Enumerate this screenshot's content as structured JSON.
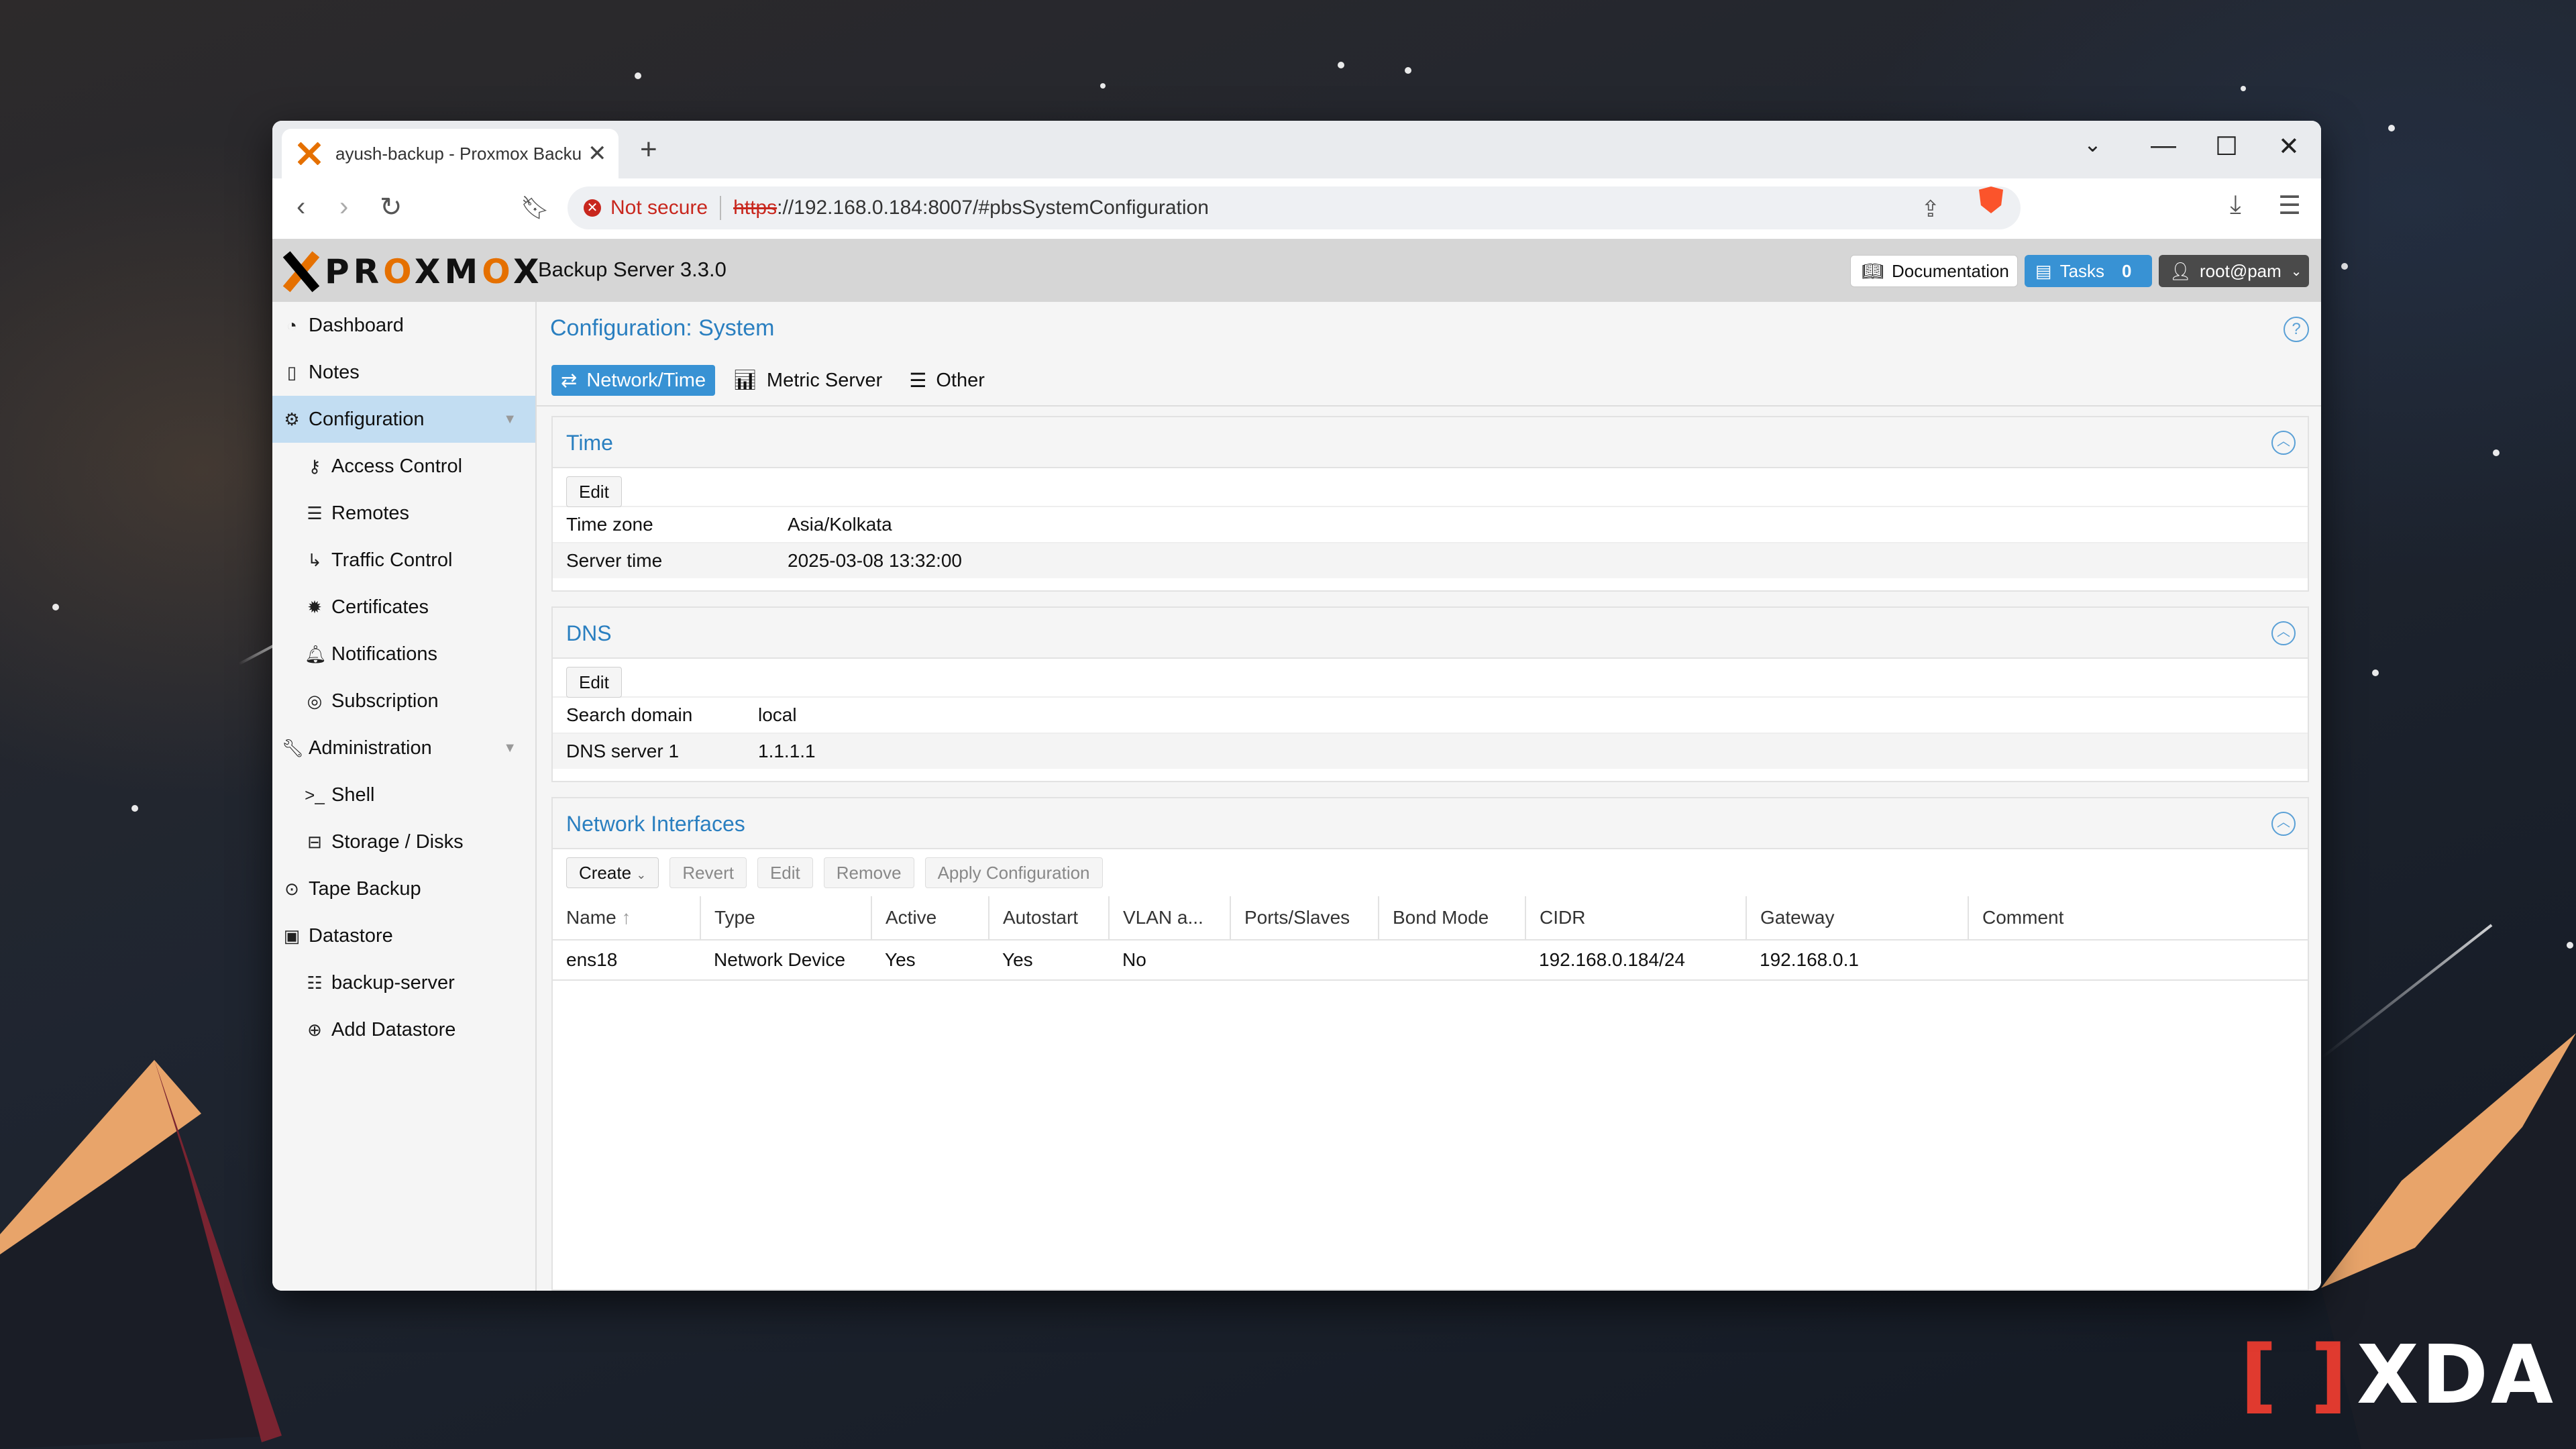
{
  "browser": {
    "tab_title": "ayush-backup - Proxmox Backu",
    "not_secure": "Not secure",
    "url_scheme": "https",
    "url_rest": "://192.168.0.184:8007/#pbsSystemConfiguration"
  },
  "header": {
    "product_word_a": "PR",
    "product_word_o": "O",
    "product_word_b": "XM",
    "product_word_o2": "O",
    "product_word_c": "X",
    "version": "Backup Server 3.3.0",
    "documentation": "Documentation",
    "tasks_label": "Tasks",
    "tasks_count": "0",
    "user": "root@pam"
  },
  "sidebar": {
    "items": [
      {
        "label": "Dashboard"
      },
      {
        "label": "Notes"
      },
      {
        "label": "Configuration"
      },
      {
        "label": "Access Control"
      },
      {
        "label": "Remotes"
      },
      {
        "label": "Traffic Control"
      },
      {
        "label": "Certificates"
      },
      {
        "label": "Notifications"
      },
      {
        "label": "Subscription"
      },
      {
        "label": "Administration"
      },
      {
        "label": "Shell"
      },
      {
        "label": "Storage / Disks"
      },
      {
        "label": "Tape Backup"
      },
      {
        "label": "Datastore"
      },
      {
        "label": "backup-server"
      },
      {
        "label": "Add Datastore"
      }
    ]
  },
  "main": {
    "title": "Configuration: System",
    "tabs": [
      {
        "label": "Network/Time"
      },
      {
        "label": "Metric Server"
      },
      {
        "label": "Other"
      }
    ],
    "time": {
      "title": "Time",
      "edit": "Edit",
      "rows": [
        {
          "key": "Time zone",
          "value": "Asia/Kolkata"
        },
        {
          "key": "Server time",
          "value": "2025-03-08 13:32:00"
        }
      ]
    },
    "dns": {
      "title": "DNS",
      "edit": "Edit",
      "rows": [
        {
          "key": "Search domain",
          "value": "local"
        },
        {
          "key": "DNS server 1",
          "value": "1.1.1.1"
        }
      ]
    },
    "network": {
      "title": "Network Interfaces",
      "buttons": {
        "create": "Create",
        "revert": "Revert",
        "edit": "Edit",
        "remove": "Remove",
        "apply": "Apply Configuration"
      },
      "columns": [
        "Name",
        "Type",
        "Active",
        "Autostart",
        "VLAN a...",
        "Ports/Slaves",
        "Bond Mode",
        "CIDR",
        "Gateway",
        "Comment"
      ],
      "rows": [
        [
          "ens18",
          "Network Device",
          "Yes",
          "Yes",
          "No",
          "",
          "",
          "192.168.0.184/24",
          "192.168.0.1",
          ""
        ]
      ]
    }
  },
  "watermark": "XDA"
}
